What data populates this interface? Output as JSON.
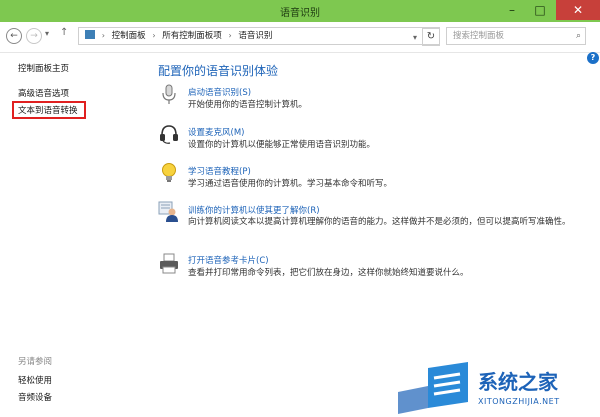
{
  "window": {
    "title": "语音识别",
    "minimize_icon": "minimize-icon",
    "maximize_icon": "maximize-icon",
    "close_icon": "close-icon",
    "accent_color": "#7ec850"
  },
  "addressbar": {
    "back_icon": "back-arrow-icon",
    "forward_icon": "forward-arrow-icon",
    "up_icon": "up-arrow-icon",
    "breadcrumb": [
      "控制面板",
      "所有控制面板项",
      "语音识别"
    ],
    "refresh_icon": "refresh-icon",
    "search_placeholder": "搜索控制面板"
  },
  "sidebar": {
    "items": [
      {
        "label": "控制面板主页"
      },
      {
        "label": "高级语音选项"
      },
      {
        "label": "文本到语音转换",
        "highlighted": true
      }
    ],
    "see_also_title": "另请参阅",
    "see_also": [
      {
        "label": "轻松使用"
      },
      {
        "label": "音频设备"
      }
    ]
  },
  "main": {
    "heading": "配置你的语音识别体验",
    "items": [
      {
        "icon": "microphone-icon",
        "link": "启动语音识别(S)",
        "desc": "开始使用你的语音控制计算机。"
      },
      {
        "icon": "headset-icon",
        "link": "设置麦克风(M)",
        "desc": "设置你的计算机以便能够正常使用语音识别功能。"
      },
      {
        "icon": "lightbulb-icon",
        "link": "学习语音教程(P)",
        "desc": "学习通过语音使用你的计算机。学习基本命令和听写。"
      },
      {
        "icon": "user-training-icon",
        "link": "训练你的计算机以使其更了解你(R)",
        "desc": "向计算机阅读文本以提高计算机理解你的语音的能力。这样做并不是必须的，但可以提高听写准确性。"
      },
      {
        "icon": "printer-icon",
        "link": "打开语音参考卡片(C)",
        "desc": "查看并打印常用命令列表，把它们放在身边，这样你就始终知道要说什么。"
      }
    ]
  },
  "watermark": {
    "text": "系统之家",
    "url": "XITONGZHIJIA.NET"
  }
}
